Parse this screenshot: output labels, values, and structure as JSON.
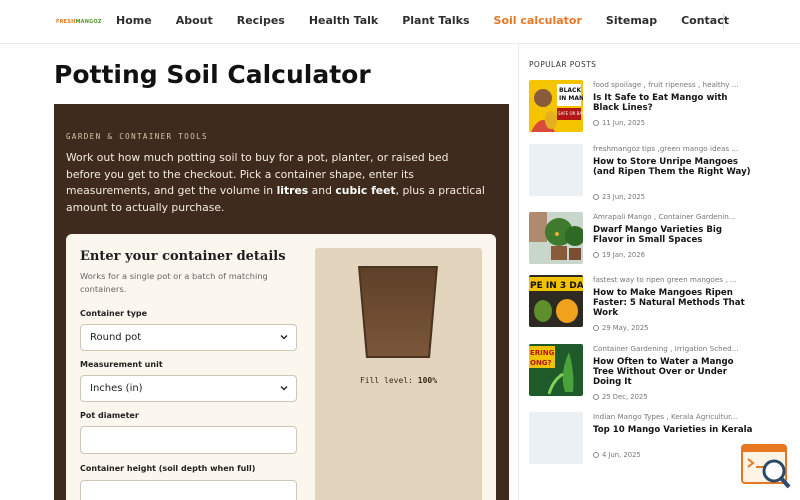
{
  "header": {
    "logo_part1": "FRESH",
    "logo_part2": "MANGOZ",
    "nav": [
      {
        "label": "Home",
        "active": false
      },
      {
        "label": "About",
        "active": false
      },
      {
        "label": "Recipes",
        "active": false
      },
      {
        "label": "Health Talk",
        "active": false
      },
      {
        "label": "Plant Talks",
        "active": false
      },
      {
        "label": "Soil calculator",
        "active": true
      },
      {
        "label": "Sitemap",
        "active": false
      },
      {
        "label": "Contact",
        "active": false
      }
    ]
  },
  "main": {
    "title": "Potting Soil Calculator",
    "eyebrow": "GARDEN & CONTAINER TOOLS",
    "desc_part1": "Work out how much potting soil to buy for a pot, planter, or raised bed before you get to the checkout. Pick a container shape, enter its measurements, and get the volume in ",
    "desc_bold1": "litres",
    "desc_part2": " and ",
    "desc_bold2": "cubic feet",
    "desc_part3": ", plus a practical amount to actually purchase.",
    "form": {
      "title": "Enter your container details",
      "subtitle": "Works for a single pot or a batch of matching containers.",
      "container_type_label": "Container type",
      "container_type_value": "Round pot",
      "unit_label": "Measurement unit",
      "unit_value": "Inches (in)",
      "diameter_label": "Pot diameter",
      "diameter_value": "",
      "height_label": "Container height (soil depth when full)",
      "height_value": ""
    },
    "visual": {
      "fill_label": "Fill level:",
      "fill_value": "100%",
      "fill_fraction": 1.0
    }
  },
  "sidebar": {
    "title": "POPULAR POSTS",
    "posts": [
      {
        "tags": "food spoilage , fruit ripeness , healthy ...",
        "title": "Is It Safe to Eat Mango with Black Lines?",
        "date": "11 Jun, 2025",
        "thumb_text": "BLACK LI IN MANG SAFE OR BAN"
      },
      {
        "tags": "freshmangoz tips ,green mango ideas ...",
        "title": "How to Store Unripe Mangoes (and Ripen Them the Right Way)",
        "date": "23 Jun, 2025",
        "thumb_text": ""
      },
      {
        "tags": "Amrapali Mango , Container Gardenin...",
        "title": "Dwarf Mango Varieties Big Flavor in Small Spaces",
        "date": "19 Jan, 2026",
        "thumb_text": ""
      },
      {
        "tags": "fastest way to ripen green mangoes , ...",
        "title": "How to Make Mangoes Ripen Faster: 5 Natural Methods That Work",
        "date": "29 May, 2025",
        "thumb_text": "PE IN 3 DAY"
      },
      {
        "tags": "Container Gardening , Irrigation Sched...",
        "title": "How Often to Water a Mango Tree Without Over or Under Doing It",
        "date": "25 Dec, 2025",
        "thumb_text": "ERING ONG?"
      },
      {
        "tags": "Indian Mango Types , Kerala Agricultur...",
        "title": "Top 10 Mango Varieties in Kerala",
        "date": "4 Jun, 2025",
        "thumb_text": ""
      }
    ]
  },
  "colors": {
    "accent": "#e87722",
    "hero_bg": "#3f2b1e",
    "card_bg": "#fbf6ee",
    "viz_bg": "#e2d4bd",
    "soil": "#6b4a2e"
  }
}
